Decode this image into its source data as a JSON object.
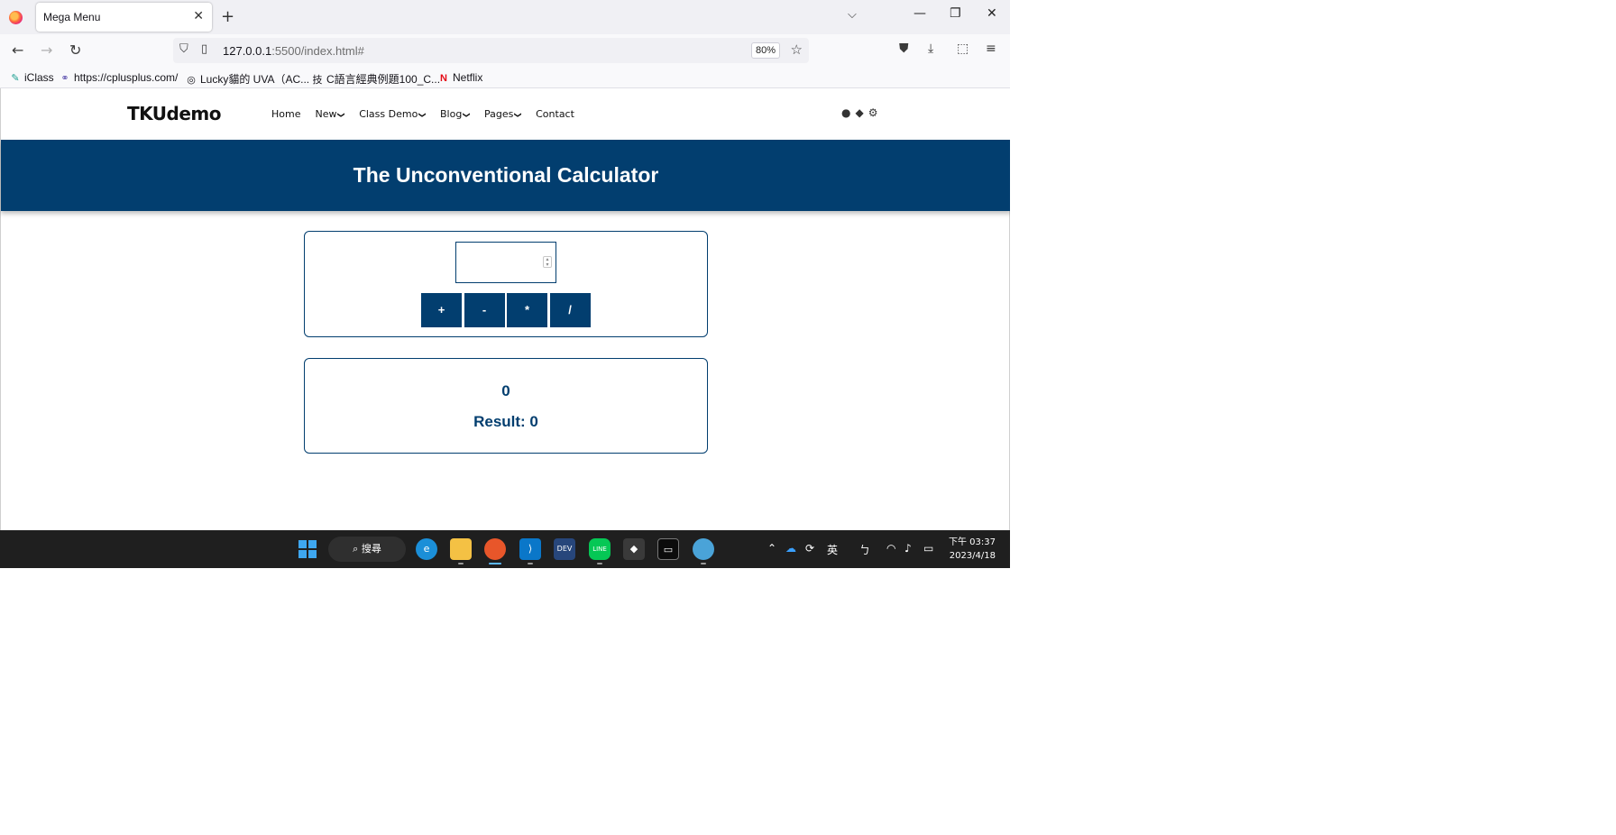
{
  "browser": {
    "tab_title": "Mega Menu",
    "tab_close": "✕",
    "new_tab": "+",
    "url_host": "127.0.0.1",
    "url_rest": ":5500/index.html#",
    "zoom": "80%",
    "bookmarks": [
      {
        "label": "iClass",
        "icon": "pencil-icon"
      },
      {
        "label": "https://cplusplus.com/",
        "icon": "cplusplus-icon"
      },
      {
        "label": "Lucky貓的 UVA（AC...",
        "icon": "globe-icon"
      },
      {
        "label": "C語言經典例題100_C...",
        "icon": "tech-icon"
      },
      {
        "label": "Netflix",
        "icon": "netflix-icon"
      }
    ]
  },
  "site": {
    "logo": "TKUdemo",
    "menu": [
      {
        "label": "Home",
        "dropdown": false
      },
      {
        "label": "New",
        "dropdown": true
      },
      {
        "label": "Class Demo",
        "dropdown": true
      },
      {
        "label": "Blog",
        "dropdown": true
      },
      {
        "label": "Pages",
        "dropdown": true
      },
      {
        "label": "Contact",
        "dropdown": false
      }
    ],
    "hero_title": "The Unconventional Calculator"
  },
  "calculator": {
    "input_value": "",
    "operators": [
      "+",
      "-",
      "*",
      "/"
    ],
    "current_value": "0",
    "result": "Result: 0"
  },
  "taskbar": {
    "search_label": "搜尋",
    "ime": "英",
    "ime2": "ㄅ",
    "time": "下午 03:37",
    "date": "2023/4/18"
  },
  "colors": {
    "primary": "#023e6f",
    "taskbar": "#1f1f1f"
  }
}
